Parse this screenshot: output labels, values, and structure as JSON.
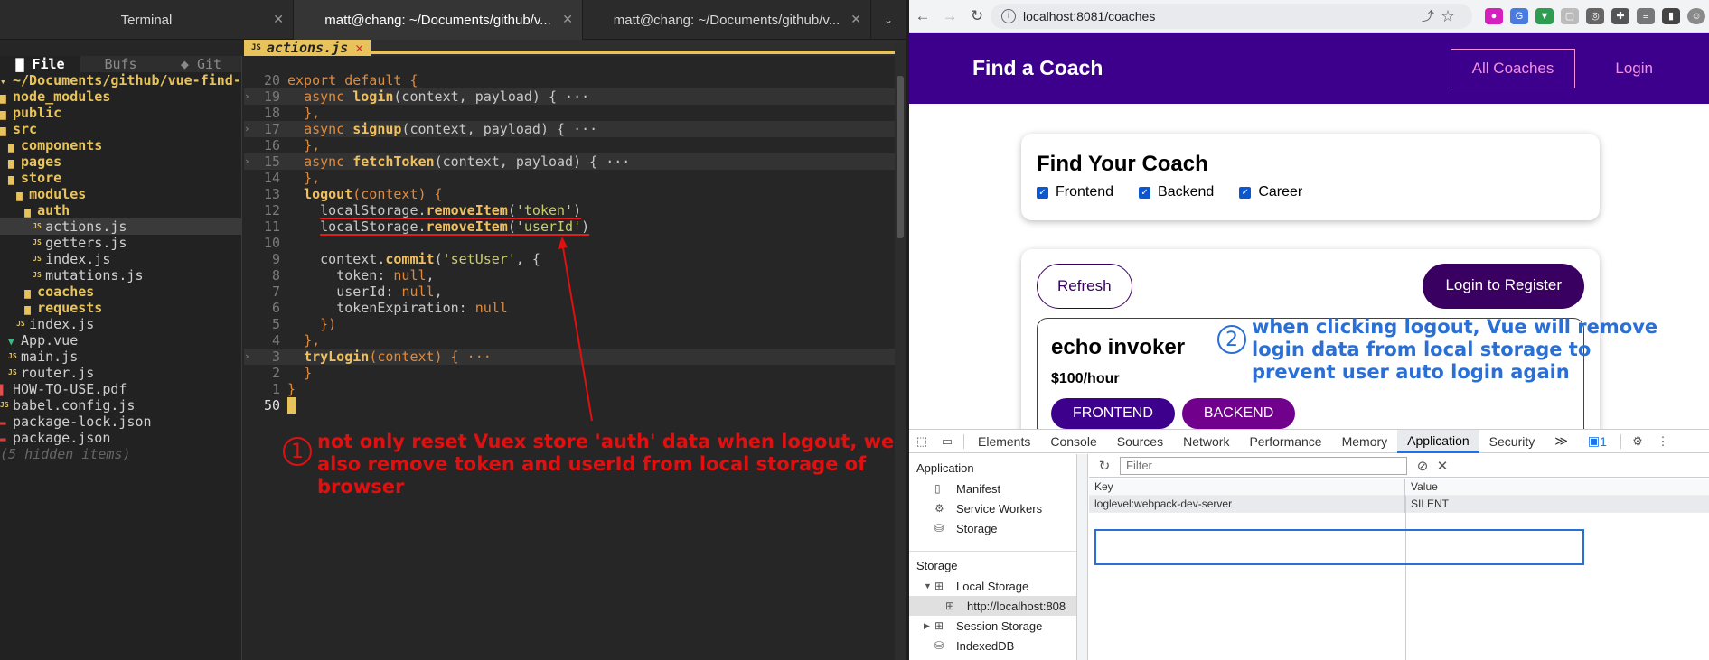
{
  "terminal": {
    "tabs": [
      {
        "label": "Terminal",
        "close": "✕"
      },
      {
        "label": "matt@chang: ~/Documents/github/v...",
        "close": "✕"
      },
      {
        "label": "matt@chang: ~/Documents/github/v...",
        "close": "✕"
      }
    ],
    "tab_overflow": "⌄"
  },
  "nerdtree": {
    "tabs": [
      "File",
      "Bufs",
      "Git"
    ],
    "root": "~/Documents/github/vue-find-",
    "items": [
      "node_modules",
      "public",
      "src",
      "components",
      "pages",
      "store",
      "modules",
      "auth",
      "actions.js",
      "getters.js",
      "index.js",
      "mutations.js",
      "coaches",
      "requests",
      "index.js",
      "App.vue",
      "main.js",
      "router.js",
      "HOW-TO-USE.pdf",
      "babel.config.js",
      "package-lock.json",
      "package.json",
      "(5 hidden items)"
    ]
  },
  "editor": {
    "filename": "actions.js",
    "file_icon": "JS",
    "close": "✕",
    "line_numbers": [
      "20",
      "19",
      "18",
      "17",
      "16",
      "15",
      "14",
      "13",
      "12",
      "11",
      "10",
      "9",
      "8",
      "7",
      "6",
      "5",
      "4",
      "3",
      "2",
      "1",
      "50"
    ],
    "lines": {
      "l1": "export default {",
      "l2a": "async ",
      "l2b": "login",
      "l2c": "(context, payload) { ···",
      "l3": "},",
      "l4a": "async ",
      "l4b": "signup",
      "l4c": "(context, payload) { ···",
      "l5": "},",
      "l6a": "async ",
      "l6b": "fetchToken",
      "l6c": "(context, payload) { ···",
      "l7": "},",
      "l8a": "logout",
      "l8b": "(context) {",
      "l9a": "localStorage.",
      "l9b": "removeItem",
      "l9c": "(",
      "l9d": "'token'",
      "l9e": ")",
      "l10a": "localStorage.",
      "l10b": "removeItem",
      "l10c": "(",
      "l10d": "'userId'",
      "l10e": ")",
      "l12a": "context.",
      "l12b": "commit",
      "l12c": "(",
      "l12d": "'setUser'",
      "l12e": ", {",
      "l13a": "token: ",
      "l13b": "null",
      "l13c": ",",
      "l14a": "userId: ",
      "l14b": "null",
      "l14c": ",",
      "l15a": "tokenExpiration: ",
      "l15b": "null",
      "l16": "})",
      "l17": "},",
      "l18a": "tryLogin",
      "l18b": "(context) { ···",
      "l19": "}",
      "l20": "}"
    }
  },
  "annotations": {
    "one_num": "1",
    "one_text": "not only reset Vuex store 'auth' data when logout, we also remove token and userId from local storage of browser",
    "two_num": "2",
    "two_text": "when clicking logout, Vue will remove login data from local storage to prevent user auto login again",
    "red": "#e01010",
    "blue": "#2a6fd6"
  },
  "browser": {
    "url": "localhost:8081/coaches",
    "app": {
      "brand": "Find a Coach",
      "nav": [
        "All Coaches",
        "Login"
      ],
      "nav_bg": "#3d008d",
      "link_color": "#f391e3"
    },
    "filter": {
      "title": "Find Your Coach",
      "options": [
        "Frontend",
        "Backend",
        "Career"
      ]
    },
    "list": {
      "refresh": "Refresh",
      "register": "Login to Register",
      "coach_name": "echo invoker",
      "coach_rate": "$100/hour",
      "areas": [
        "FRONTEND",
        "BACKEND"
      ]
    }
  },
  "devtools": {
    "tabs": [
      "Elements",
      "Console",
      "Sources",
      "Network",
      "Performance",
      "Memory",
      "Application",
      "Security"
    ],
    "more": "≫",
    "issues": "1",
    "application_header": "Application",
    "application_items": [
      "Manifest",
      "Service Workers",
      "Storage"
    ],
    "storage_header": "Storage",
    "storage_items": [
      "Local Storage",
      "http://localhost:808",
      "Session Storage",
      "IndexedDB"
    ],
    "filter_placeholder": "Filter",
    "columns": [
      "Key",
      "Value"
    ],
    "rows": [
      {
        "key": "loglevel:webpack-dev-server",
        "value": "SILENT"
      }
    ]
  }
}
